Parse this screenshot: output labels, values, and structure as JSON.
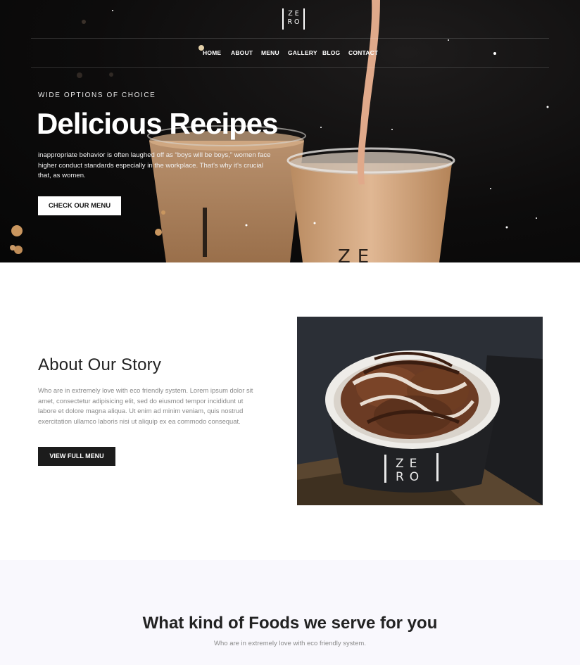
{
  "brand": {
    "logo_top": "ZE",
    "logo_bottom": "RO"
  },
  "nav": {
    "items": [
      "HOME",
      "ABOUT",
      "MENU",
      "GALLERY",
      "BLOG",
      "CONTACT"
    ]
  },
  "hero": {
    "eyebrow": "WIDE OPTIONS OF CHOICE",
    "title": "Delicious Recipes",
    "description": "inappropriate behavior is often laughed off as “boys will be boys,” women face higher conduct standards especially in the workplace. That’s why it’s crucial that, as women.",
    "cta_label": "CHECK OUR MENU"
  },
  "about": {
    "title": "About Our Story",
    "description": "Who are in extremely love with eco friendly system. Lorem ipsum dolor sit amet, consectetur adipisicing elit, sed do eiusmod tempor incididunt ut labore et dolore magna aliqua. Ut enim ad minim veniam, quis nostrud exercitation ullamco laboris nisi ut aliquip ex ea commodo consequat.",
    "cta_label": "VIEW FULL MENU",
    "cup_logo_top": "ZE",
    "cup_logo_bottom": "RO"
  },
  "foods": {
    "title": "What kind of Foods we serve for you",
    "subtitle": "Who are in extremely love with eco friendly system."
  },
  "colors": {
    "hero_bg": "#0b0a0a",
    "dark_button": "#1c1c1c",
    "section_bg": "#f9f8fd",
    "muted_text": "#8a8a8a"
  }
}
